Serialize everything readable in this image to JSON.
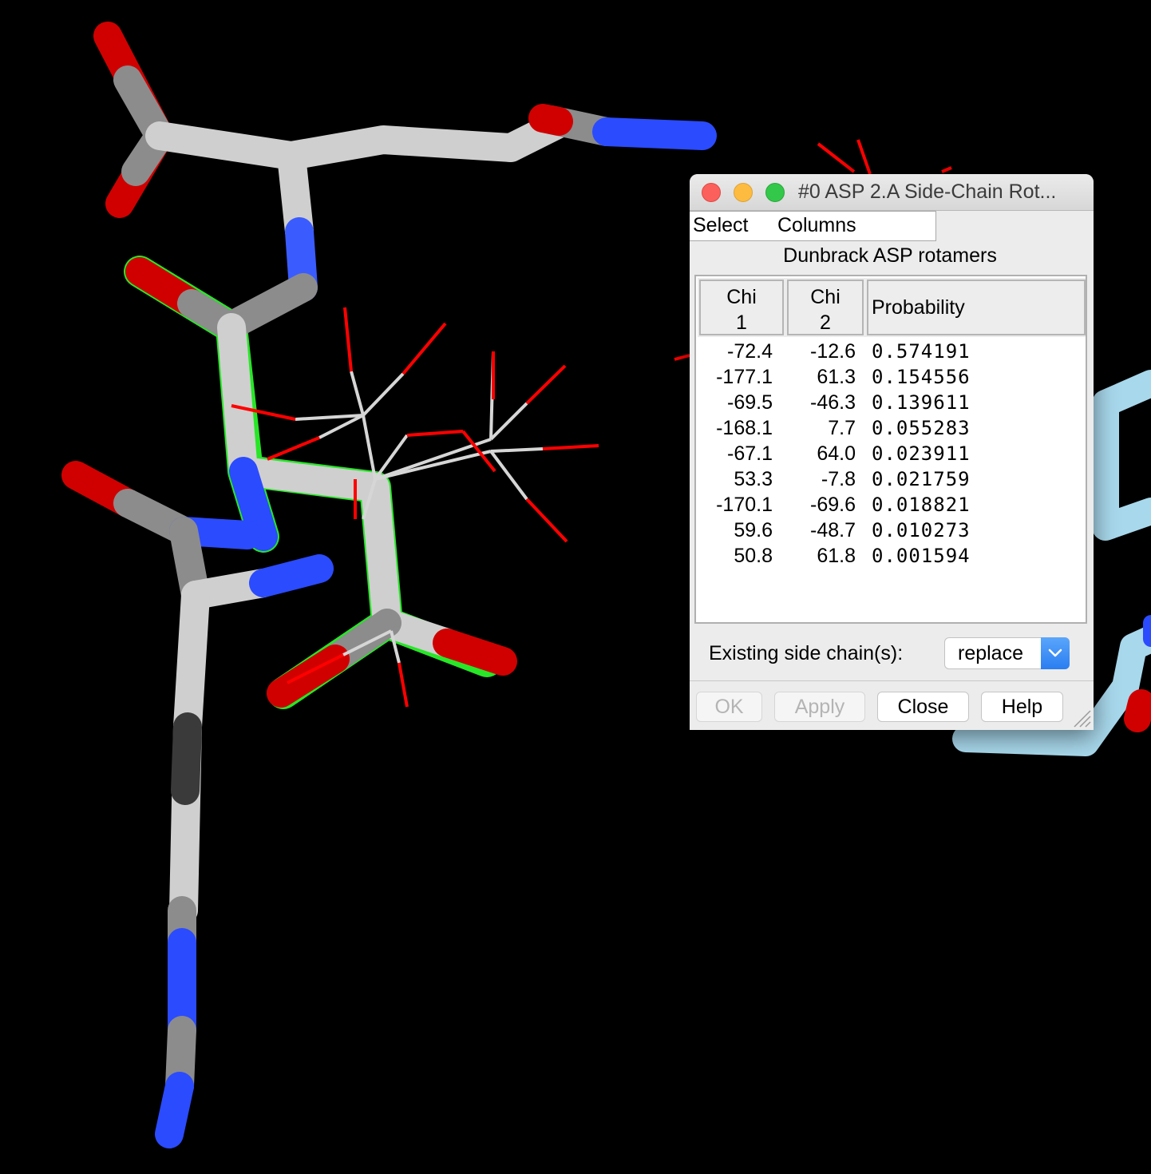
{
  "window": {
    "title": "#0 ASP 2.A Side-Chain Rot..."
  },
  "menus": [
    "Select",
    "Columns"
  ],
  "table": {
    "caption": "Dunbrack ASP rotamers",
    "headers": {
      "chi1": "Chi\n1",
      "chi2": "Chi\n2",
      "probability": "Probability"
    },
    "rows": [
      {
        "chi1": "-72.4",
        "chi2": "-12.6",
        "probability": "0.574191"
      },
      {
        "chi1": "-177.1",
        "chi2": "61.3",
        "probability": "0.154556"
      },
      {
        "chi1": "-69.5",
        "chi2": "-46.3",
        "probability": "0.139611"
      },
      {
        "chi1": "-168.1",
        "chi2": "7.7",
        "probability": "0.055283"
      },
      {
        "chi1": "-67.1",
        "chi2": "64.0",
        "probability": "0.023911"
      },
      {
        "chi1": "53.3",
        "chi2": "-7.8",
        "probability": "0.021759"
      },
      {
        "chi1": "-170.1",
        "chi2": "-69.6",
        "probability": "0.018821"
      },
      {
        "chi1": "59.6",
        "chi2": "-48.7",
        "probability": "0.010273"
      },
      {
        "chi1": "50.8",
        "chi2": "61.8",
        "probability": "0.001594"
      }
    ]
  },
  "existing_side_chains": {
    "label": "Existing side chain(s):",
    "value": "replace"
  },
  "buttons": {
    "ok": "OK",
    "apply": "Apply",
    "close": "Close",
    "help": "Help"
  },
  "colors": {
    "oxygen": "#e00000",
    "nitrogen": "#2b4bff",
    "carbon": "#8c8c8c",
    "bond_white": "#d9d9d9",
    "selection_green": "#2cff2c",
    "second_chain": "#a8d8ec",
    "background": "#000000"
  }
}
